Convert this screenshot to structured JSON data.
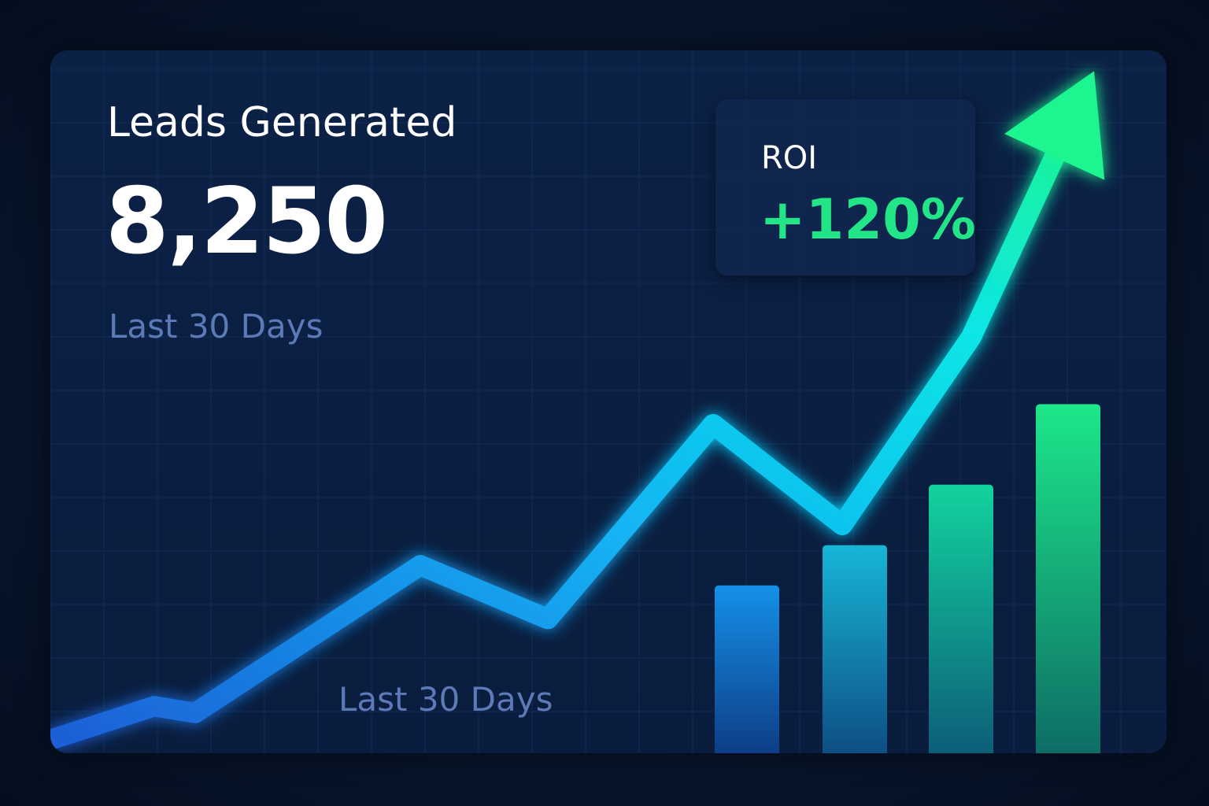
{
  "metric": {
    "title": "Leads Generated",
    "value": "8,250",
    "period": "Last 30 Days"
  },
  "roi": {
    "label": "ROI",
    "value": "+120%"
  },
  "colors": {
    "line_start": "#1c6fe6",
    "line_mid": "#11c6f5",
    "line_end": "#1cf590",
    "bar_blue": "#1590e8",
    "bar_green": "#1ce08a",
    "accent_green": "#21e587",
    "muted_text": "#5d7ab8"
  },
  "chart_data": {
    "type": "line",
    "grid": true,
    "xlabel": "Last 30 Days",
    "trend_arrow": true,
    "line": {
      "x": [
        0,
        1,
        2,
        3,
        4,
        5,
        6,
        7,
        8
      ],
      "y": [
        2,
        7,
        6,
        28,
        20,
        49,
        34,
        62,
        95
      ]
    },
    "bars": {
      "type": "bar",
      "values": [
        25,
        31,
        40,
        52
      ]
    }
  }
}
